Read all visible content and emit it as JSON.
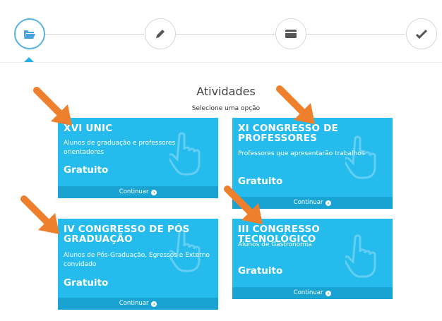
{
  "stepper": {
    "steps": [
      {
        "icon": "folder-open-icon",
        "active": true
      },
      {
        "icon": "pencil-icon",
        "active": false
      },
      {
        "icon": "credit-card-icon",
        "active": false
      },
      {
        "icon": "checkmark-icon",
        "active": false
      }
    ],
    "accent_color": "#5ab1e3"
  },
  "page": {
    "title": "Atividades",
    "subtitle": "Selecione uma opção"
  },
  "cards": [
    {
      "title": "XVI UNIC",
      "description": "Alunos de graduação e professores orientadores",
      "price": "Gratuito",
      "action": "Continuar"
    },
    {
      "title": "XI CONGRESSO DE PROFESSORES",
      "description": "Professores que apresentarão trabalhos",
      "price": "Gratuito",
      "action": "Continuar"
    },
    {
      "title": "IV CONGRESSO DE PÓS GRADUAÇÃO",
      "description": "Alunos de Pós-Graduação, Egressos e Externo convidado",
      "price": "Gratuito",
      "action": "Continuar"
    },
    {
      "title": "III CONGRESSO TECNOLÓGICO",
      "description": "Alunos de Gastronomia",
      "price": "Gratuito",
      "action": "Continuar"
    }
  ],
  "colors": {
    "card_background": "#25bced",
    "card_footer": "#18a3d3",
    "annotation_arrow": "#ee7f2d"
  },
  "icons": {
    "card_decoration": "pointing-hand-icon",
    "continue": "arrow-circle-right-icon",
    "annotation": "orange-arrow-icon"
  }
}
